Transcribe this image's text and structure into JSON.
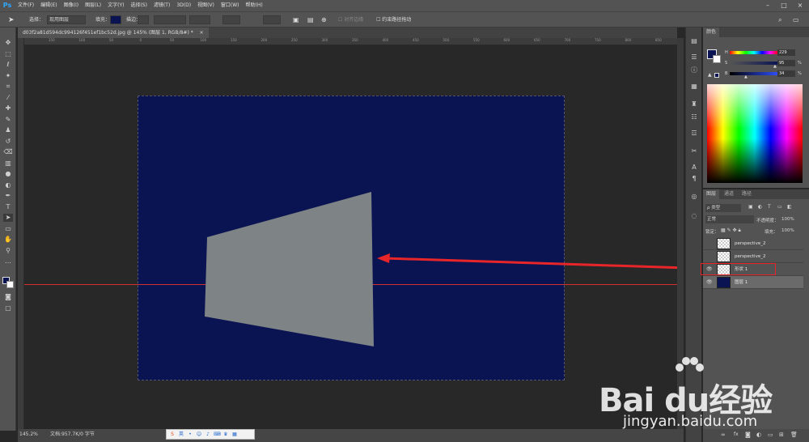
{
  "app": {
    "logo": "Ps",
    "brand_color": "#31a8ff"
  },
  "menu": [
    "文件(F)",
    "编辑(E)",
    "图像(I)",
    "图层(L)",
    "文字(Y)",
    "选择(S)",
    "滤镜(T)",
    "3D(D)",
    "视图(V)",
    "窗口(W)",
    "帮助(H)"
  ],
  "options": {
    "select_label": "选择：",
    "select_value": "现用图层",
    "fill_label": "填充：",
    "stroke_label": "描边：",
    "align_edges": "对齐边缘",
    "constrain_path": "约束路径拖动",
    "fill_color": "#0a1452"
  },
  "document": {
    "tab_title": "d03f2a81d594dc994126f451ef1bc52d.jpg @ 145% (图层 1, RGB/8#) *",
    "canvas_color": "#0a1452",
    "shape_color": "#7e8385"
  },
  "ruler_ticks": [
    "150",
    "100",
    "50",
    "0",
    "50",
    "100",
    "150",
    "200",
    "250",
    "300",
    "350",
    "400",
    "450",
    "500",
    "550",
    "600",
    "650",
    "700",
    "750",
    "800",
    "850"
  ],
  "status": {
    "zoom": "145.2%",
    "doc_info": "文档:957.7K/0 字节"
  },
  "ime": {
    "label": "英"
  },
  "color_panel": {
    "tab": "颜色",
    "h_label": "H",
    "h_value": "229",
    "s_label": "S",
    "s_value": "95",
    "b_label": "B",
    "b_value": "34",
    "pct": "%",
    "foreground": "#0a1452"
  },
  "layers_panel": {
    "tabs": [
      "图层",
      "通道",
      "路径"
    ],
    "filter_label": "ρ 类型",
    "blend_mode": "正常",
    "opacity_label": "不透明度：",
    "opacity_value": "100%",
    "lock_label": "锁定：",
    "fill_label": "填充：",
    "fill_value": "100%",
    "layers": [
      {
        "name": "perspective_2",
        "visible": false
      },
      {
        "name": "perspective_2",
        "visible": false
      },
      {
        "name": "形状 1",
        "visible": true
      },
      {
        "name": "图层 1",
        "visible": true
      }
    ]
  },
  "watermark": {
    "logo": "Bai du经验",
    "url": "jingyan.baidu.com"
  }
}
